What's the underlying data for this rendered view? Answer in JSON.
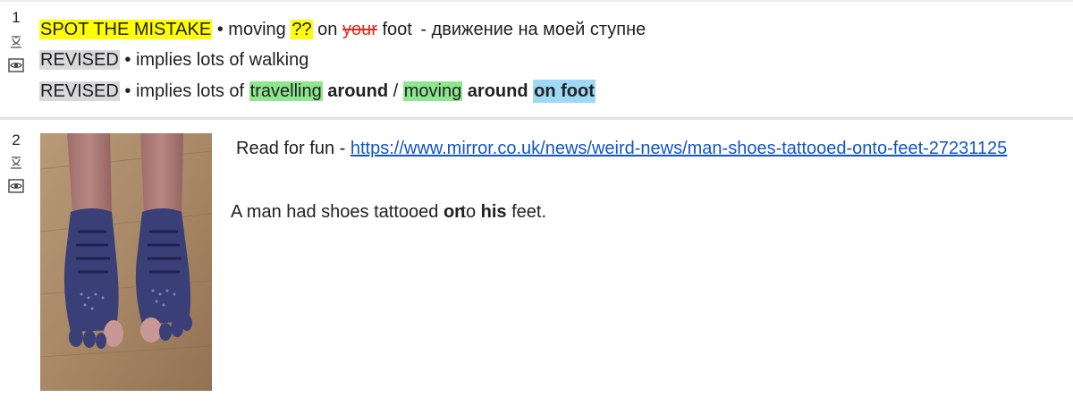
{
  "rows": [
    {
      "number": "1",
      "lines": [
        {
          "label": "SPOT THE MISTAKE",
          "bullet": "•",
          "w1": "moving",
          "qq": "??",
          "w2": "on",
          "struck": "your",
          "w3": "foot",
          "sep": "-",
          "russian": "движение на моей ступне"
        },
        {
          "label": "REVISED",
          "bullet": "•",
          "text": "implies lots of walking"
        },
        {
          "label": "REVISED",
          "bullet": "•",
          "lead": "implies lots of",
          "g1": "travelling",
          "a1": "around",
          "slash": "/",
          "g2": "moving",
          "a2": "around",
          "onfoot": "on foot"
        }
      ]
    },
    {
      "number": "2",
      "read_prefix": "Read for fun -",
      "link": "https://www.mirror.co.uk/news/weird-news/man-shoes-tattooed-onto-feet-27231125",
      "s1": "A man had shoes tattooed",
      "on": "on",
      "to": "to",
      "his": "his",
      "s2": "feet."
    }
  ],
  "colors": {
    "yellow_highlight": "#ffff00",
    "gray_highlight": "#d9d9d9",
    "green_highlight": "#8ee68e",
    "blue_highlight": "#9fd9f6",
    "strike_red": "#d93025",
    "link_blue": "#1155cc"
  },
  "icons": [
    "translate-icon",
    "eye-icon"
  ]
}
